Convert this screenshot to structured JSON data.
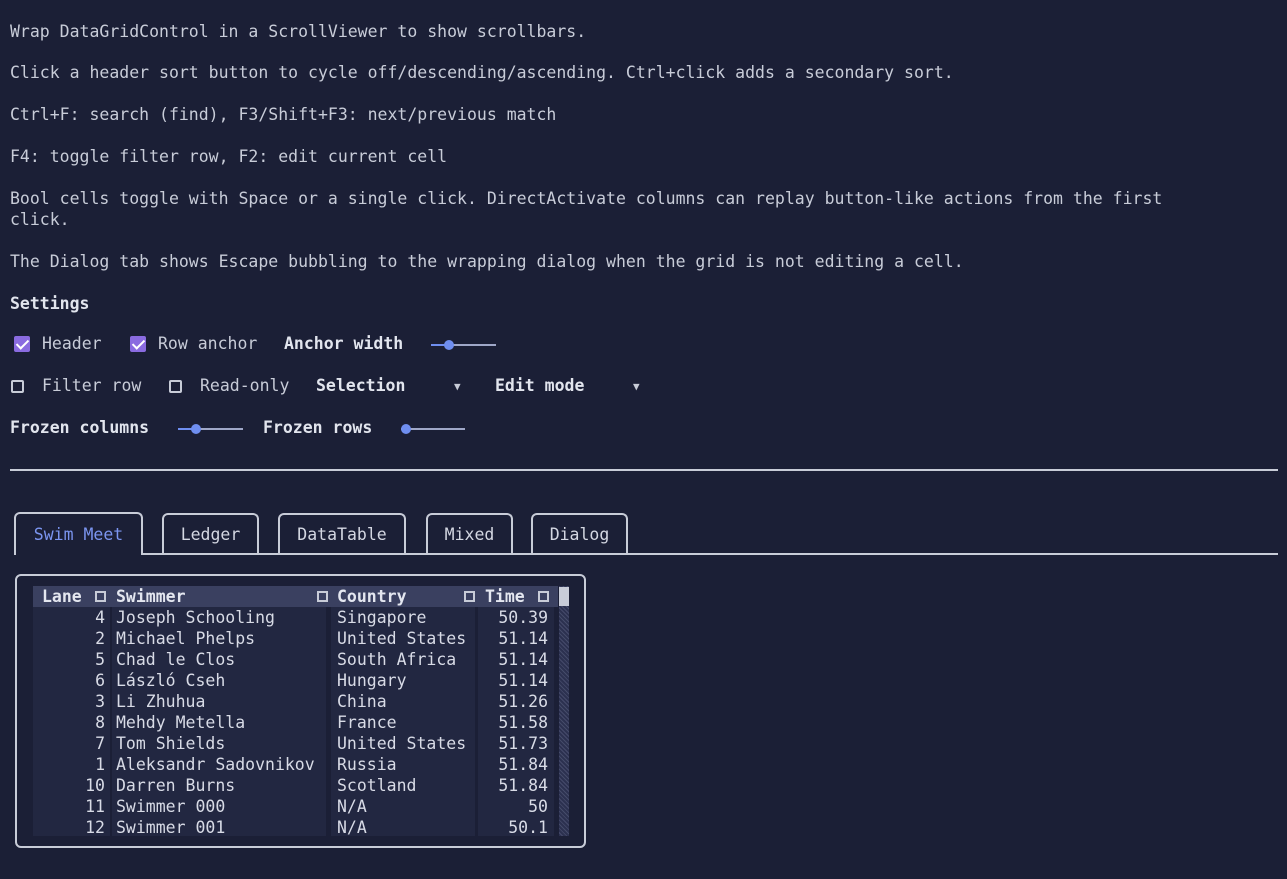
{
  "instructions": [
    "Wrap DataGridControl in a ScrollViewer to show scrollbars.",
    "Click a header sort button to cycle off/descending/ascending. Ctrl+click adds a secondary sort.",
    "Ctrl+F: search (find), F3/Shift+F3: next/previous match",
    "F4: toggle filter row, F2: edit current cell",
    "Bool cells toggle with Space or a single click. DirectActivate columns can replay button-like actions from the first",
    "click.",
    "The Dialog tab shows Escape bubbling to the wrapping dialog when the grid is not editing a cell."
  ],
  "settings": {
    "title": "Settings",
    "header": {
      "label": "Header",
      "checked": true
    },
    "row_anchor": {
      "label": "Row anchor",
      "checked": true
    },
    "anchor_width": {
      "label": "Anchor width",
      "value": 0.27
    },
    "filter_row": {
      "label": "Filter row",
      "checked": false
    },
    "read_only": {
      "label": "Read-only",
      "checked": false
    },
    "selection": {
      "label": "Selection",
      "value": ""
    },
    "edit_mode": {
      "label": "Edit mode",
      "value": ""
    },
    "frozen_columns": {
      "label": "Frozen columns",
      "value": 0.27
    },
    "frozen_rows": {
      "label": "Frozen rows",
      "value": 0
    }
  },
  "tabs": [
    {
      "label": "Swim Meet",
      "active": true
    },
    {
      "label": "Ledger",
      "active": false
    },
    {
      "label": "DataTable",
      "active": false
    },
    {
      "label": "Mixed",
      "active": false
    },
    {
      "label": "Dialog",
      "active": false
    }
  ],
  "grid": {
    "columns": [
      "Lane",
      "Swimmer",
      "Country",
      "Time"
    ],
    "rows": [
      [
        "4",
        "Joseph Schooling",
        "Singapore",
        "50.39"
      ],
      [
        "2",
        "Michael Phelps",
        "United States",
        "51.14"
      ],
      [
        "5",
        "Chad le Clos",
        "South Africa",
        "51.14"
      ],
      [
        "6",
        "László Cseh",
        "Hungary",
        "51.14"
      ],
      [
        "3",
        "Li Zhuhua",
        "China",
        "51.26"
      ],
      [
        "8",
        "Mehdy Metella",
        "France",
        "51.58"
      ],
      [
        "7",
        "Tom Shields",
        "United States",
        "51.73"
      ],
      [
        "1",
        "Aleksandr Sadovnikov",
        "Russia",
        "51.84"
      ],
      [
        "10",
        "Darren Burns",
        "Scotland",
        "51.84"
      ],
      [
        "11",
        "Swimmer 000",
        "N/A",
        "50"
      ],
      [
        "12",
        "Swimmer 001",
        "N/A",
        "50.1"
      ]
    ]
  },
  "colors": {
    "background": "#1b1f36",
    "accent": "#7b95f0",
    "checkbox": "#8a6be0"
  }
}
